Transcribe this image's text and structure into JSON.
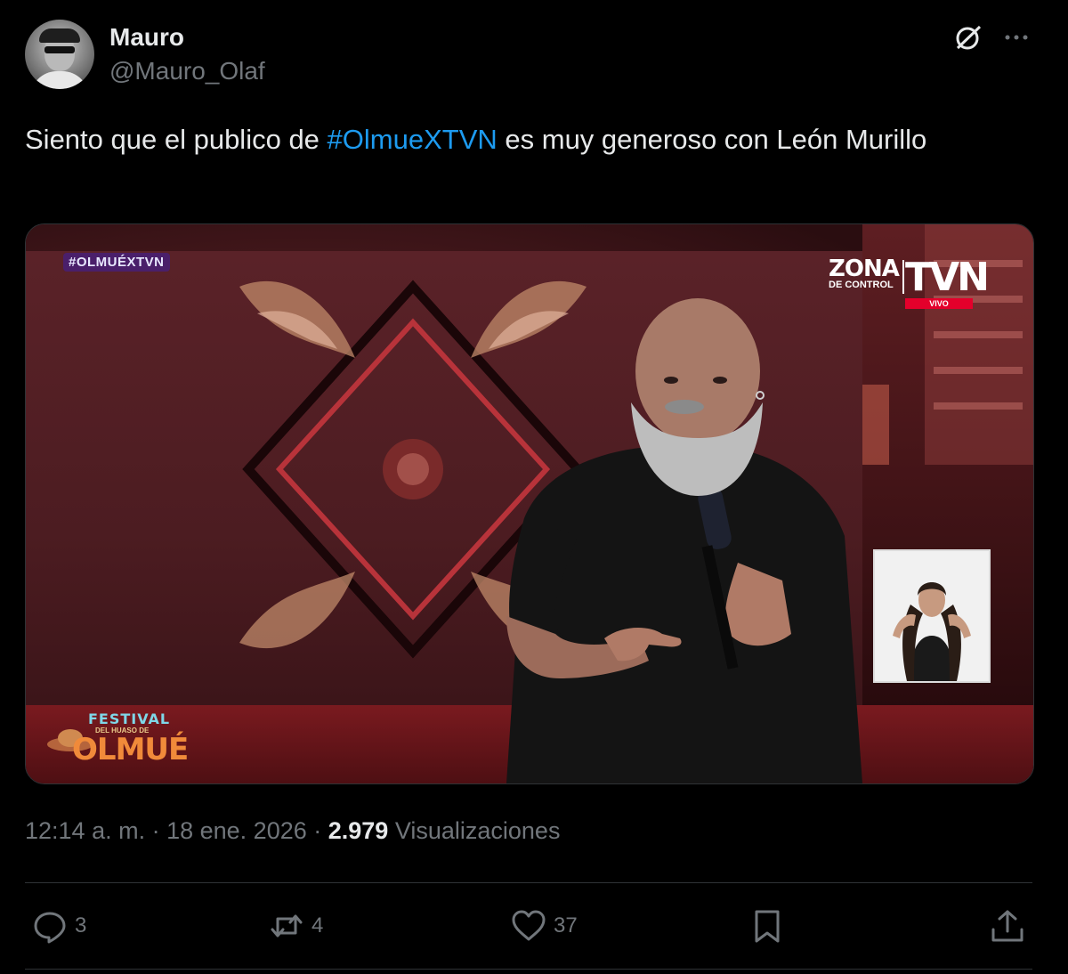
{
  "author": {
    "name": "Mauro",
    "handle": "@Mauro_Olaf"
  },
  "tweet": {
    "text_before": "Siento que el publico de ",
    "hashtag": "#OlmueXTVN",
    "text_after": " es muy generoso con León Murillo"
  },
  "media": {
    "hashtag_overlay": "#OLMUÉXTVN",
    "zona_line1": "ZONA",
    "zona_line2": "DE CONTROL",
    "channel": "TVN",
    "live_badge": "VIVO",
    "festival_line1": "FESTIVAL",
    "festival_line2": "DEL HUASO DE",
    "festival_line3": "OLMUÉ"
  },
  "meta": {
    "time": "12:14 a. m.",
    "sep1": " · ",
    "date": "18 ene. 2026",
    "sep2": " · ",
    "views_count": "2.979",
    "views_label": " Visualizaciones"
  },
  "actions": {
    "replies": "3",
    "reposts": "4",
    "likes": "37"
  },
  "icons": [
    "grok-icon",
    "more-icon",
    "reply-icon",
    "repost-icon",
    "like-icon",
    "bookmark-icon",
    "share-icon"
  ],
  "colors": {
    "hashtag": "#1d9bf0",
    "muted": "#71767b",
    "text": "#e7e9ea",
    "background": "#000000"
  }
}
